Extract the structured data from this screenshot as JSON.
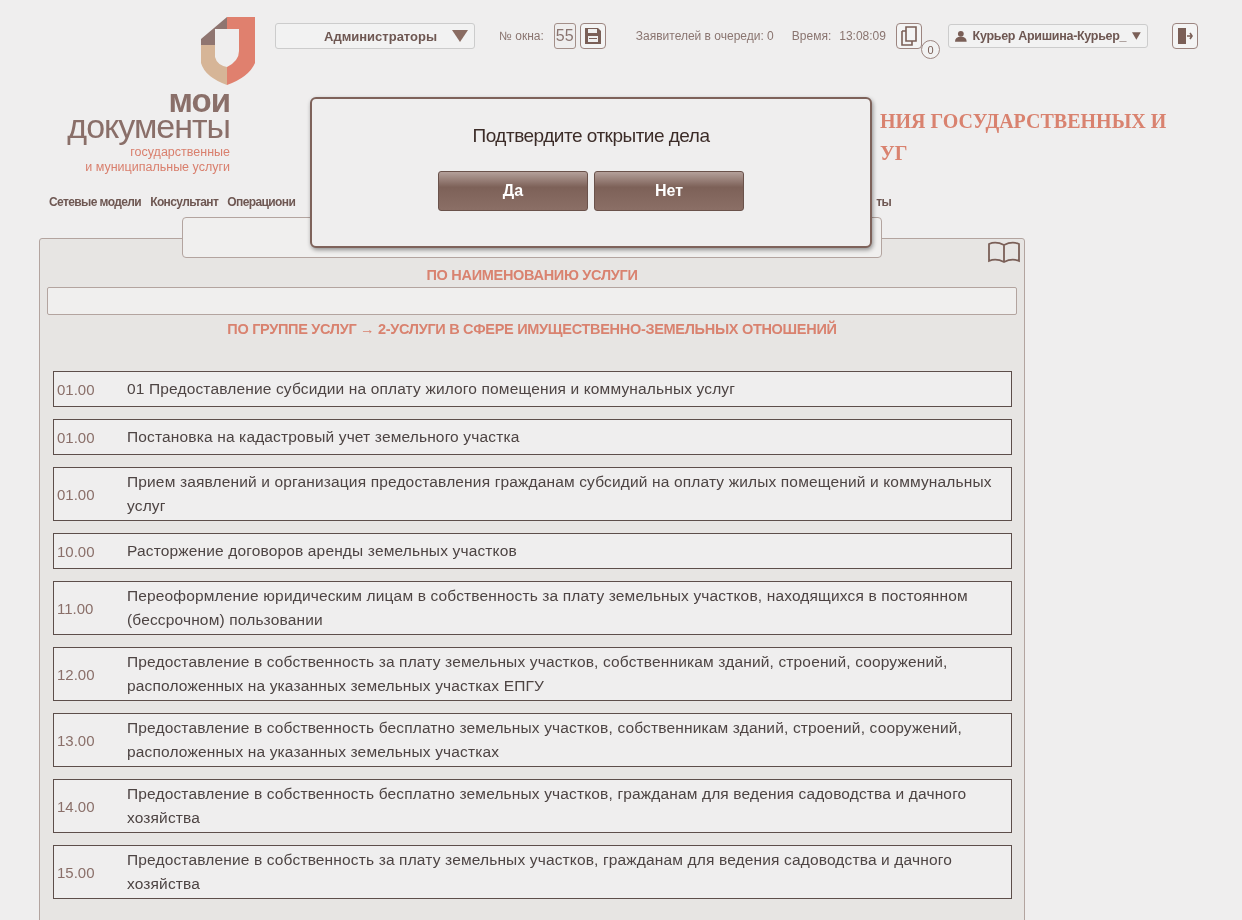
{
  "logo": {
    "line1": "мои",
    "line2": "документы",
    "line3": "государственные",
    "line4": "и муниципальные услуги"
  },
  "topbar": {
    "group": "Администраторы",
    "window_label": "№ окна:",
    "window_number": "55",
    "queue": "Заявителей в очереди: 0",
    "time_label": "Время:",
    "time": "13:08:09",
    "documents_count": "0",
    "user": "Курьер Аришина-Курьер_"
  },
  "page_title": {
    "line1": "НИЯ ГОСУДАРСТВЕННЫХ И",
    "line2": "УГ"
  },
  "nav": [
    "Сетевые модели",
    "Консультант",
    "Операциони"
  ],
  "nav_tail": "ты",
  "search": {
    "by_name": "ПО НАИМЕНОВАНИЮ УСЛУГИ",
    "by_group": "ПО ГРУППЕ УСЛУГ",
    "group_arrow": "→",
    "group": "2-УСЛУГИ В СФЕРЕ ИМУЩЕСТВЕННО-ЗЕМЕЛЬНЫХ ОТНОШЕНИЙ"
  },
  "services": [
    {
      "code": "01.00",
      "name": "01 Предоставление субсидии на оплату жилого помещения и коммунальных услуг"
    },
    {
      "code": "01.00",
      "name": "Постановка на кадастровый учет земельного участка"
    },
    {
      "code": "01.00",
      "name": "Прием заявлений и организация предоставления гражданам субсидий на оплату жилых помещений и коммунальных услуг"
    },
    {
      "code": "10.00",
      "name": "Расторжение договоров аренды земельных участков"
    },
    {
      "code": "11.00",
      "name": "Переоформление юридическим лицам в собственность за плату земельных участков, находящихся в постоянном (бессрочном) пользовании"
    },
    {
      "code": "12.00",
      "name": "Предоставление в собственность за плату земельных участков, собственникам зданий, строений, сооружений, расположенных на указанных земельных участках ЕПГУ"
    },
    {
      "code": "13.00",
      "name": "Предоставление в собственность бесплатно земельных участков, собственникам зданий, строений, сооружений, расположенных на указанных земельных участках"
    },
    {
      "code": "14.00",
      "name": "Предоставление в собственность бесплатно земельных участков, гражданам для ведения садоводства и дачного хозяйства"
    },
    {
      "code": "15.00",
      "name": "Предоставление в собственность за плату земельных участков, гражданам для ведения садоводства и дачного хозяйства"
    }
  ],
  "dialog": {
    "message": "Подтвердите открытие дела",
    "buttons": [
      "Да",
      "Нет"
    ]
  }
}
